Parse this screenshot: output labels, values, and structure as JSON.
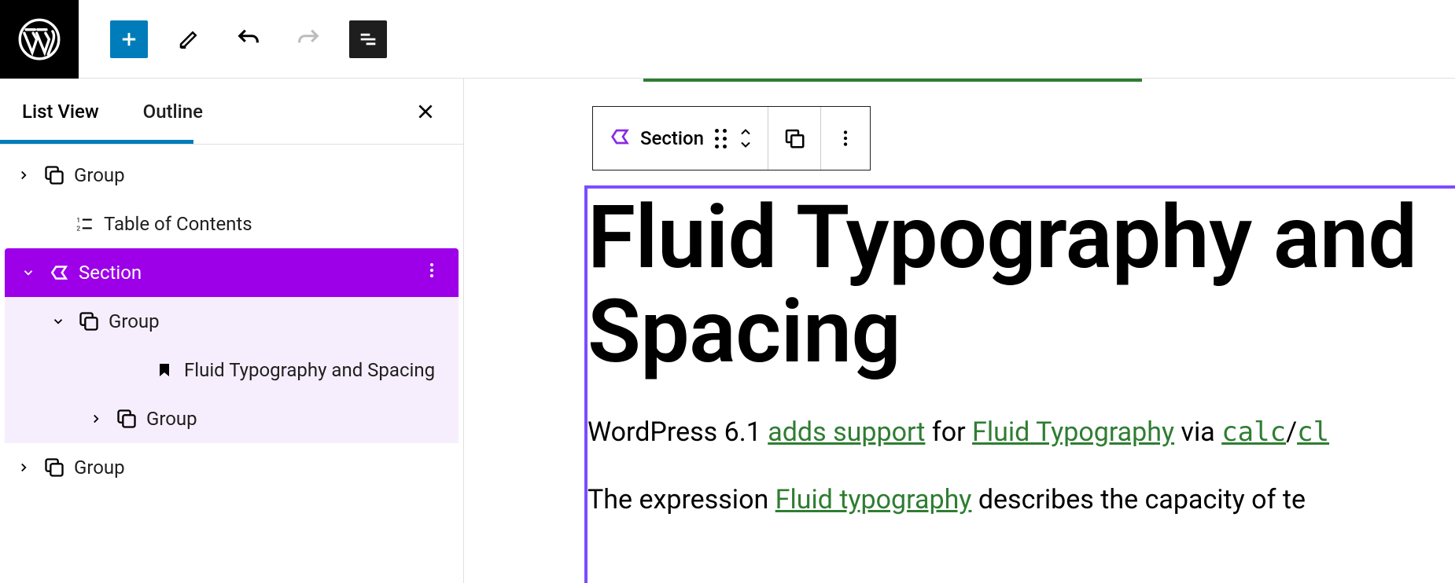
{
  "toolbar": {
    "wp_logo": "WordPress"
  },
  "sidebar": {
    "tabs": {
      "list_view": "List View",
      "outline": "Outline"
    },
    "tree": [
      {
        "label": "Group",
        "type": "group"
      },
      {
        "label": "Table of Contents",
        "type": "toc"
      },
      {
        "label": "Section",
        "type": "section"
      },
      {
        "label": "Group",
        "type": "group"
      },
      {
        "label": "Fluid Typography and Spacing",
        "type": "heading"
      },
      {
        "label": "Group",
        "type": "group"
      },
      {
        "label": "Group",
        "type": "group"
      }
    ]
  },
  "block_toolbar": {
    "type_label": "Section"
  },
  "content": {
    "heading": "Fluid Typography and Spacing",
    "para1_pre": "WordPress 6.1 ",
    "para1_link1": "adds support",
    "para1_mid": " for ",
    "para1_link2": "Fluid Typography",
    "para1_via": " via ",
    "para1_code1": "calc",
    "para1_slash": "/",
    "para1_code2": "cl",
    "para2_pre": "The expression ",
    "para2_link1": "Fluid typography",
    "para2_post": " describes the capacity of te"
  },
  "colors": {
    "accent": "#007cba",
    "selected": "#9d00e8",
    "section_border": "#7c4dff",
    "link_green": "#2f7d32"
  }
}
